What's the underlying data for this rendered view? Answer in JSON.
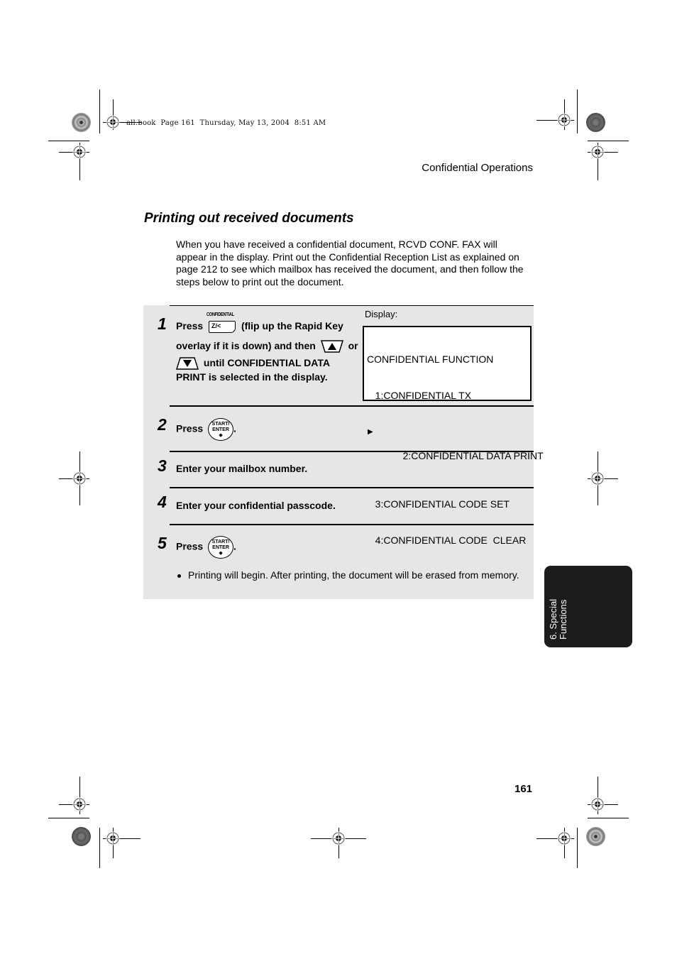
{
  "book_header": "all.book  Page 161  Thursday, May 13, 2004  8:51 AM",
  "running_head": "Confidential Operations",
  "section_title": "Printing out received documents",
  "intro_text": "When you have received a confidential document, RCVD CONF. FAX will appear in the display. Print out the Confidential Reception List as explained on page 212 to see which mailbox has received the document, and then follow the steps below to print out the document.",
  "steps": [
    {
      "number": "1",
      "text_press": "Press",
      "key_label_top": "CONFIDENTIAL",
      "key_face": "Z/<",
      "text_after_key": "(flip up the Rapid Key",
      "line2": "overlay if it is down) and then",
      "line2_or": "or",
      "line3": "until CONFIDENTIAL DATA",
      "line4": "PRINT is selected in the display."
    },
    {
      "number": "2",
      "text_press": "Press",
      "key_line1": "START/",
      "key_line2": "ENTER",
      "key_symbol": "◆",
      "suffix": "."
    },
    {
      "number": "3",
      "text": "Enter your mailbox number."
    },
    {
      "number": "4",
      "text": "Enter your confidential passcode."
    },
    {
      "number": "5",
      "text_press": "Press",
      "key_line1": "START/",
      "key_line2": "ENTER",
      "key_symbol": "◆",
      "suffix": ".",
      "bullet": "Printing will begin. After printing, the document will be erased from memory."
    }
  ],
  "display": {
    "label": "Display:",
    "lines": [
      "CONFIDENTIAL FUNCTION",
      "   1:CONFIDENTIAL TX",
      "   2:CONFIDENTIAL DATA PRINT",
      "   3:CONFIDENTIAL CODE SET",
      "   4:CONFIDENTIAL CODE  CLEAR"
    ],
    "selected_index": 2,
    "selector_icon": "▶"
  },
  "chapter_tab": {
    "line1": "6. Special",
    "line2": "Functions"
  },
  "page_number": "161"
}
